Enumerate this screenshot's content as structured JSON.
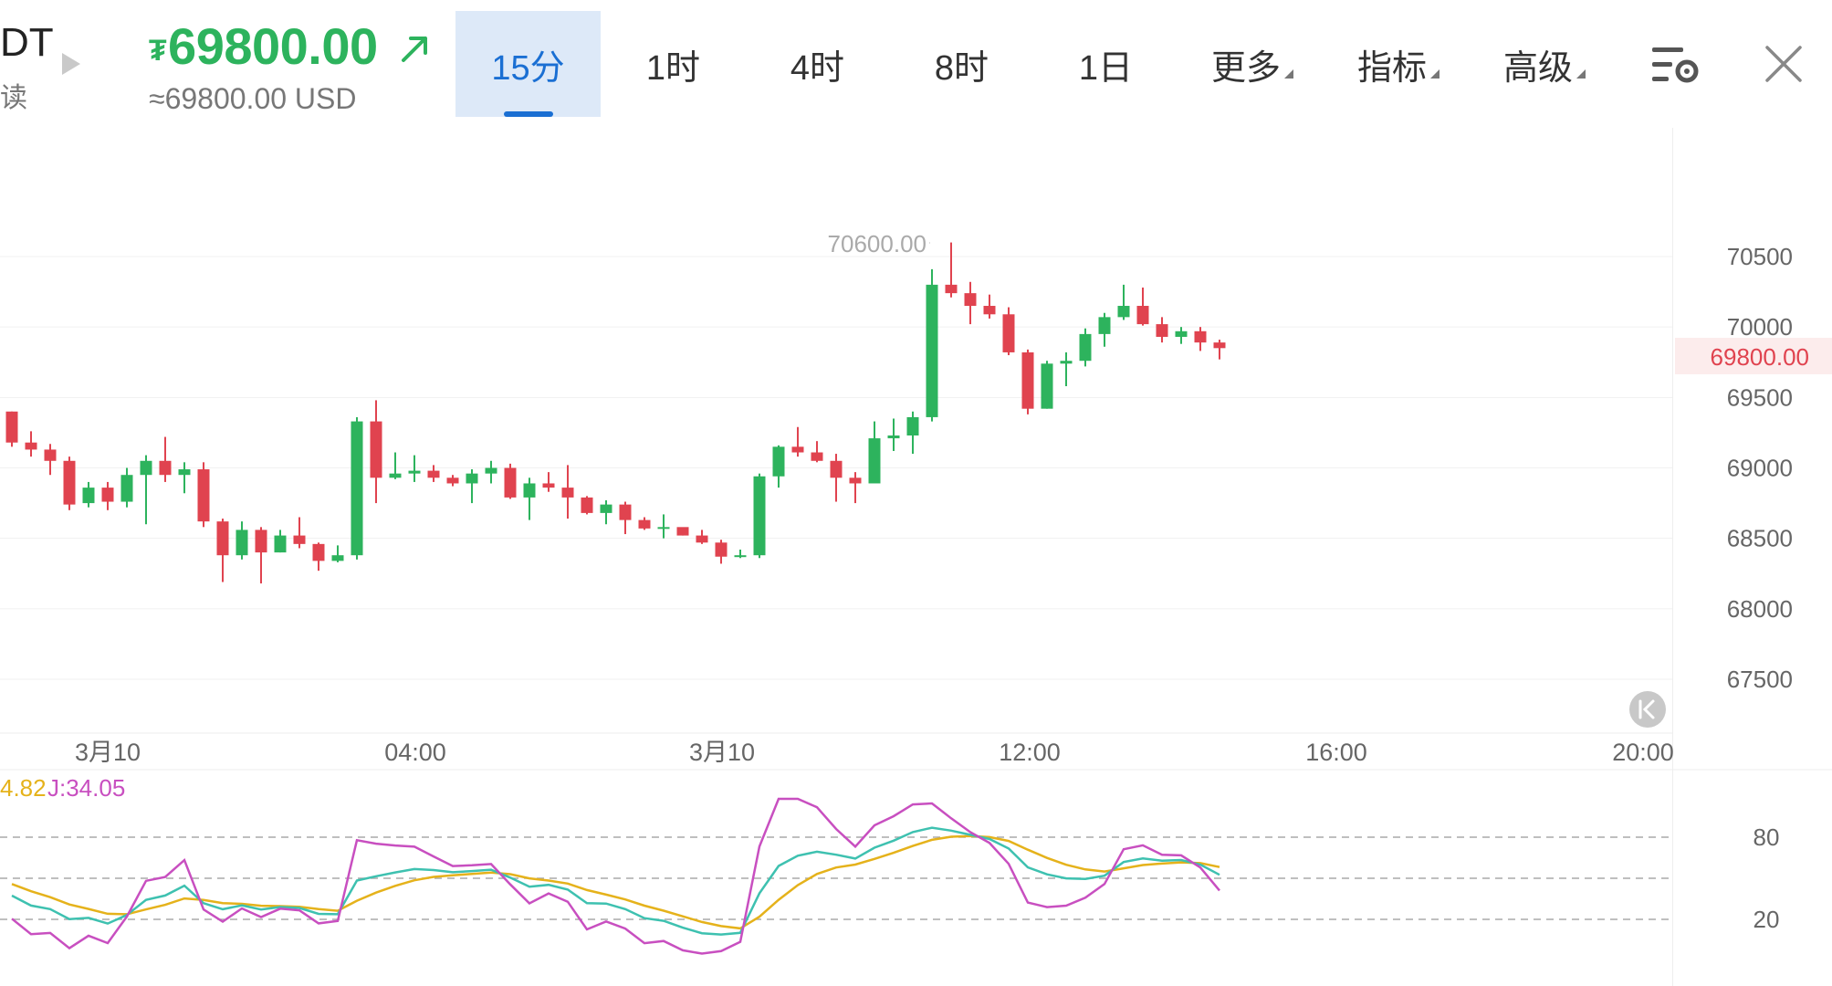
{
  "header": {
    "pair_name": "DT",
    "pair_sub": "读",
    "currency_symbol": "₮",
    "price": "69800.00",
    "price_usd": "≈69800.00 USD",
    "price_color": "#2db35d"
  },
  "tabs": [
    {
      "label": "15分",
      "active": true
    },
    {
      "label": "1时",
      "active": false
    },
    {
      "label": "4时",
      "active": false
    },
    {
      "label": "8时",
      "active": false
    },
    {
      "label": "1日",
      "active": false
    },
    {
      "label": "更多",
      "active": false,
      "caret": true
    },
    {
      "label": "指标",
      "active": false,
      "caret": true
    },
    {
      "label": "高级",
      "active": false,
      "caret": true
    }
  ],
  "icons": {
    "play": "play-icon",
    "trend": "arrow-up-right-icon",
    "settings": "chart-settings-icon",
    "close": "close-icon",
    "jump": "jump-to-latest-icon"
  },
  "chart_data": {
    "type": "candlestick",
    "timeframe": "15分",
    "y_axis_labels": [
      "70500",
      "70000",
      "69500",
      "69000",
      "68500",
      "68000",
      "67500"
    ],
    "y_range": [
      67250,
      70800
    ],
    "x_axis_labels": [
      "3月10",
      "04:00",
      "3月10",
      "12:00",
      "16:00",
      "20:00"
    ],
    "high_label": "70600.00",
    "current_price_label": "69800.00",
    "up_color": "#2db35d",
    "down_color": "#e0434f",
    "candles": [
      [
        69400,
        69180,
        69400,
        69150
      ],
      [
        69180,
        69130,
        69260,
        69080
      ],
      [
        69130,
        69050,
        69170,
        68950
      ],
      [
        69050,
        68740,
        69080,
        68700
      ],
      [
        68750,
        68860,
        68900,
        68720
      ],
      [
        68860,
        68760,
        68900,
        68700
      ],
      [
        68760,
        68950,
        69000,
        68720
      ],
      [
        68950,
        69050,
        69090,
        68600
      ],
      [
        69050,
        68950,
        69220,
        68900
      ],
      [
        68950,
        68990,
        69040,
        68820
      ],
      [
        68990,
        68620,
        69040,
        68580
      ],
      [
        68620,
        68380,
        68640,
        68190
      ],
      [
        68380,
        68560,
        68620,
        68350
      ],
      [
        68560,
        68400,
        68580,
        68180
      ],
      [
        68400,
        68520,
        68560,
        68400
      ],
      [
        68520,
        68460,
        68650,
        68430
      ],
      [
        68460,
        68340,
        68470,
        68270
      ],
      [
        68340,
        68380,
        68450,
        68330
      ],
      [
        68380,
        69330,
        69360,
        68350
      ],
      [
        69330,
        68930,
        69480,
        68750
      ],
      [
        68930,
        68960,
        69110,
        68920
      ],
      [
        68960,
        68980,
        69090,
        68900
      ],
      [
        68980,
        68930,
        69020,
        68900
      ],
      [
        68930,
        68890,
        68950,
        68870
      ],
      [
        68890,
        68960,
        68990,
        68750
      ],
      [
        68960,
        69000,
        69050,
        68890
      ],
      [
        69000,
        68790,
        69030,
        68780
      ],
      [
        68790,
        68890,
        68930,
        68630
      ],
      [
        68890,
        68860,
        68970,
        68830
      ],
      [
        68860,
        68790,
        69020,
        68640
      ],
      [
        68790,
        68680,
        68800,
        68670
      ],
      [
        68680,
        68740,
        68770,
        68600
      ],
      [
        68740,
        68630,
        68760,
        68530
      ],
      [
        68630,
        68570,
        68650,
        68560
      ],
      [
        68570,
        68580,
        68670,
        68500
      ],
      [
        68580,
        68520,
        68570,
        68520
      ],
      [
        68520,
        68470,
        68560,
        68460
      ],
      [
        68470,
        68370,
        68490,
        68320
      ],
      [
        68370,
        68380,
        68420,
        68360
      ],
      [
        68380,
        68940,
        68960,
        68360
      ],
      [
        68940,
        69150,
        69160,
        68860
      ],
      [
        69150,
        69110,
        69290,
        69080
      ],
      [
        69110,
        69050,
        69190,
        69040
      ],
      [
        69050,
        68930,
        69100,
        68760
      ],
      [
        68930,
        68890,
        68970,
        68750
      ],
      [
        68890,
        69210,
        69330,
        68900
      ],
      [
        69210,
        69230,
        69350,
        69120
      ],
      [
        69230,
        69360,
        69400,
        69100
      ],
      [
        69360,
        70300,
        70410,
        69330
      ],
      [
        70300,
        70240,
        70600,
        70210
      ],
      [
        70240,
        70150,
        70320,
        70020
      ],
      [
        70150,
        70090,
        70230,
        70060
      ],
      [
        70090,
        69820,
        70140,
        69800
      ],
      [
        69820,
        69420,
        69840,
        69380
      ],
      [
        69420,
        69740,
        69760,
        69420
      ],
      [
        69740,
        69760,
        69820,
        69580
      ],
      [
        69760,
        69950,
        69990,
        69720
      ],
      [
        69950,
        70070,
        70100,
        69860
      ],
      [
        70070,
        70150,
        70300,
        70050
      ],
      [
        70150,
        70020,
        70280,
        70010
      ],
      [
        70020,
        69930,
        70070,
        69890
      ],
      [
        69930,
        69970,
        70000,
        69880
      ],
      [
        69970,
        69890,
        70000,
        69830
      ],
      [
        69890,
        69850,
        69910,
        69770
      ]
    ],
    "kdj": {
      "label_partial": "4.82",
      "j_label": "J:34.05",
      "y_axis_labels": [
        "80",
        "20"
      ],
      "k_color": "#3ec1b0",
      "d_color": "#e5b21b",
      "j_color": "#c84fc0"
    }
  }
}
